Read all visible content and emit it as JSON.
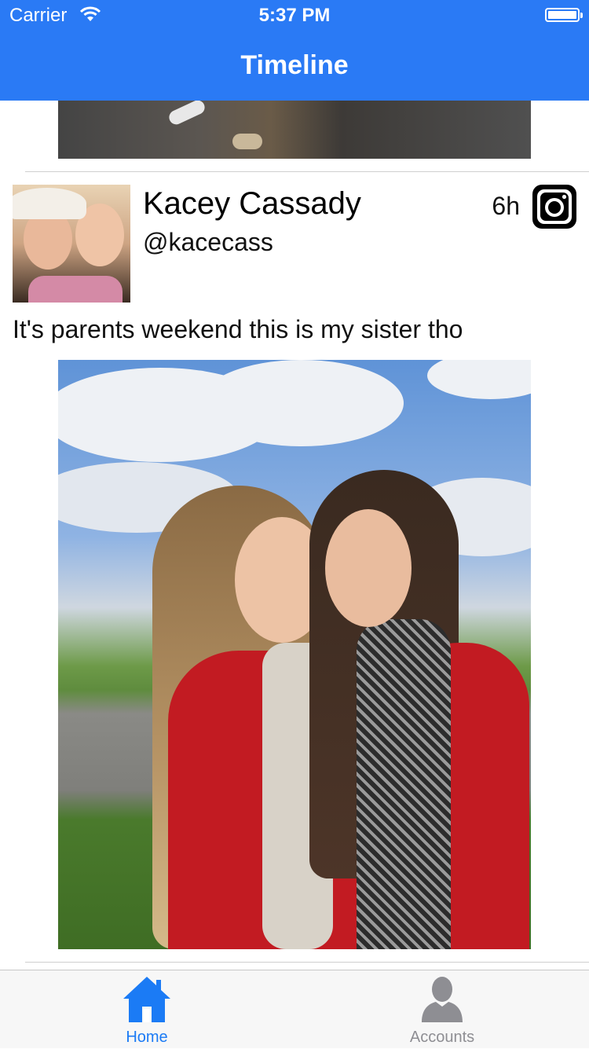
{
  "status_bar": {
    "carrier": "Carrier",
    "time": "5:37 PM"
  },
  "nav": {
    "title": "Timeline"
  },
  "post": {
    "author_name": "Kacey Cassady",
    "handle": "@kacecass",
    "time_ago": "6h",
    "source_icon": "instagram-icon",
    "text": "It's parents weekend this is my sister tho"
  },
  "tabbar": {
    "tabs": [
      {
        "label": "Home",
        "icon": "home-icon",
        "selected": true
      },
      {
        "label": "Accounts",
        "icon": "person-icon",
        "selected": false
      }
    ]
  },
  "colors": {
    "accent": "#2a7af5",
    "tab_selected": "#1b7bf5",
    "tab_unselected": "#8e8e93"
  }
}
